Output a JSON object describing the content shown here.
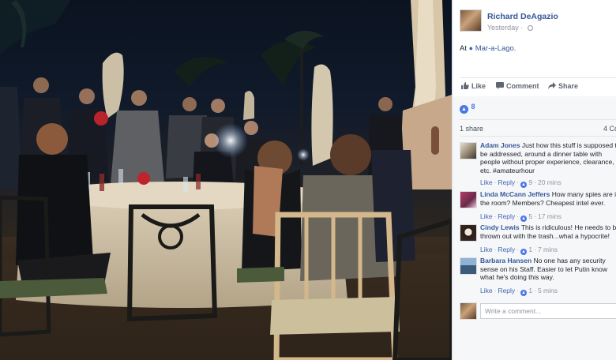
{
  "post": {
    "author": "Richard DeAgazio",
    "timestamp": "Yesterday",
    "checkin_prefix": "At",
    "location": "Mar-a-Lago."
  },
  "actions": {
    "like": "Like",
    "comment": "Comment",
    "share": "Share"
  },
  "stats": {
    "likes": "8",
    "shares": "1 share",
    "comments": "4 Co"
  },
  "comments": [
    {
      "name": "Adam Jones",
      "text": "Just how this stuff is supposed to be addressed, around a dinner table with people without proper experience, clearance, etc. #amateurhour",
      "reply": "Reply",
      "like": "Like",
      "reactions": "9",
      "time": "20 mins"
    },
    {
      "name": "Linda McCann Jeffers",
      "text": "How many spies are in the room? Members? Cheapest intel ever.",
      "reply": "Reply",
      "like": "Like",
      "reactions": "5",
      "time": "17 mins"
    },
    {
      "name": "Cindy Lewis",
      "text": "This is ridiculous! He needs to be thrown out with the trash...what a hypocrite!",
      "reply": "Reply",
      "like": "Like",
      "reactions": "1",
      "time": "7 mins"
    },
    {
      "name": "Barbara Hansen",
      "text": "No one has any security sense on his Staff. Easier to let Putin know what he's doing this way.",
      "reply": "Reply",
      "like": "Like",
      "reactions": "1",
      "time": "5 mins"
    }
  ],
  "composer": {
    "placeholder": "Write a comment..."
  },
  "colors": {
    "link": "#365899",
    "like_blue": "#4a76e6",
    "panel_bg": "#f6f7f9",
    "muted": "#90949c"
  },
  "icons": [
    "globe-icon",
    "map-pin-icon",
    "thumbs-up-icon",
    "comment-icon",
    "share-arrow-icon",
    "like-reaction-icon"
  ]
}
